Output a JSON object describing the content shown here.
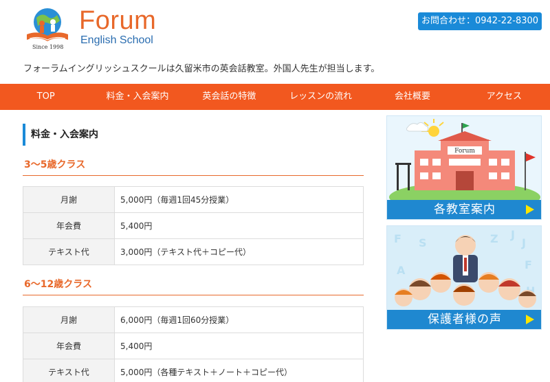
{
  "logo": {
    "title": "Forum",
    "subtitle": "English School",
    "since": "Since 1998"
  },
  "contact": {
    "label": "お問合わせ：0942-22-8300"
  },
  "tagline": "フォーラムイングリッシュスクールは久留米市の英会話教室。外国人先生が担当します。",
  "nav": {
    "items": [
      "TOP",
      "料金・入会案内",
      "英会話の特徴",
      "レッスンの流れ",
      "会社概要",
      "アクセス"
    ]
  },
  "main": {
    "page_title": "料金・入会案内",
    "classes": [
      {
        "heading": "3〜5歳クラス",
        "rows": [
          {
            "label": "月謝",
            "value": "5,000円（毎週1回45分授業）"
          },
          {
            "label": "年会費",
            "value": "5,400円"
          },
          {
            "label": "テキスト代",
            "value": "3,000円（テキスト代＋コピー代）"
          }
        ]
      },
      {
        "heading": "6〜12歳クラス",
        "rows": [
          {
            "label": "月謝",
            "value": "6,000円（毎週1回60分授業）"
          },
          {
            "label": "年会費",
            "value": "5,400円"
          },
          {
            "label": "テキスト代",
            "value": "5,000円（各種テキスト＋ノート＋コピー代）"
          }
        ]
      }
    ]
  },
  "sidebar": {
    "banners": [
      {
        "label": "各教室案内",
        "sign": "Forum"
      },
      {
        "label": "保護者様の声"
      }
    ]
  },
  "colors": {
    "accent_orange": "#f2581f",
    "accent_blue": "#1a8ad8",
    "banner_blue": "#1f88d0"
  }
}
